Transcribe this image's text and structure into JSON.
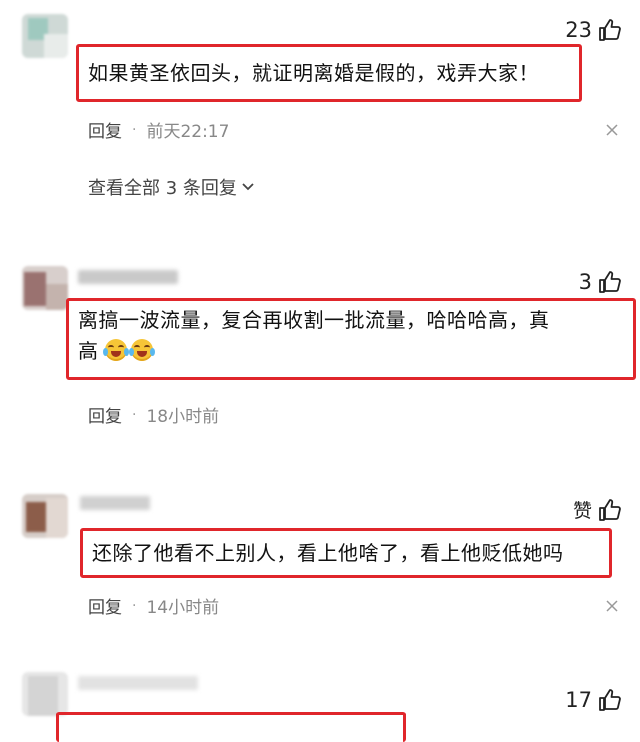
{
  "comments": [
    {
      "likes": "23",
      "text": "如果黄圣依回头，就证明离婚是假的，戏弄大家！",
      "reply_label": "回复",
      "time": "前天22:17",
      "view_replies": "查看全部 3 条回复"
    },
    {
      "likes": "3",
      "text_line1": "离搞一波流量，复合再收割一批流量，哈哈哈高，真",
      "text_line2": "高",
      "emoji": "laughing-crying-emoji",
      "reply_label": "回复",
      "time": "18小时前"
    },
    {
      "likes": "赞",
      "text": "还除了他看不上别人，看上他啥了，看上他贬低她吗",
      "reply_label": "回复",
      "time": "14小时前"
    },
    {
      "likes": "17"
    }
  ],
  "colors": {
    "highlight_border": "#e0262b",
    "meta_gray": "#888888"
  },
  "icons": [
    "thumb-up-icon",
    "close-icon",
    "chevron-down-icon"
  ]
}
